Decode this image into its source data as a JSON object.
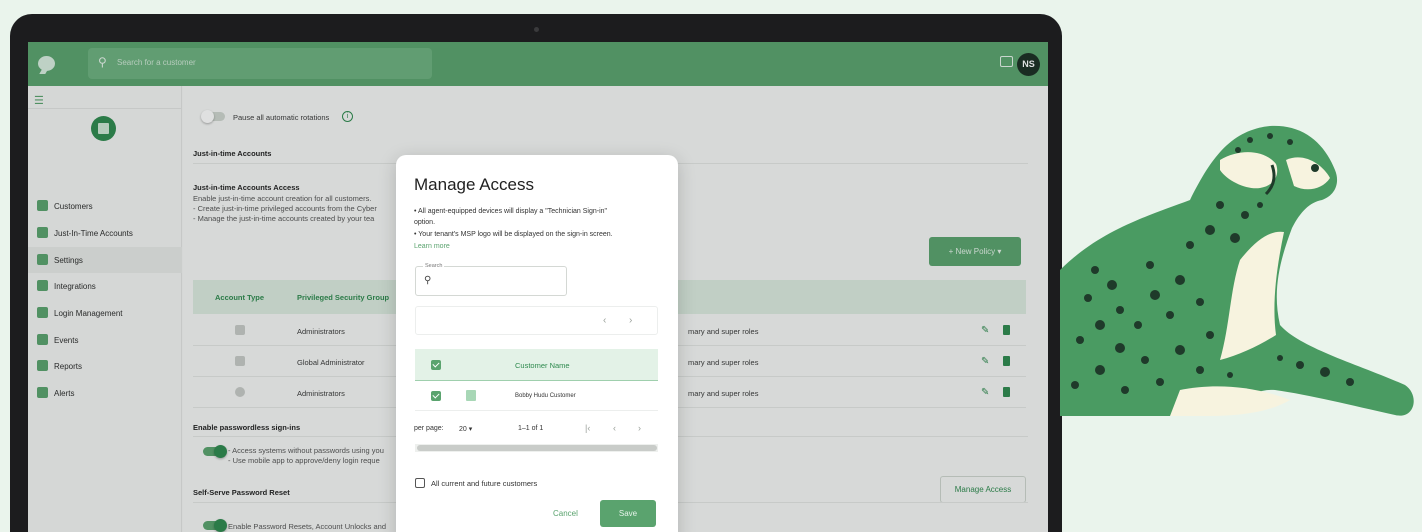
{
  "header": {
    "search_placeholder": "Search for a customer",
    "avatar_initials": "NS"
  },
  "sidebar": {
    "items": [
      {
        "label": "Customers",
        "icon": "grid-icon",
        "active": false
      },
      {
        "label": "Just-In-Time Accounts",
        "icon": "users-icon",
        "active": false
      },
      {
        "label": "Settings",
        "icon": "sliders-icon",
        "active": true
      },
      {
        "label": "Integrations",
        "icon": "plug-icon",
        "active": false
      },
      {
        "label": "Login Management",
        "icon": "hierarchy-icon",
        "active": false
      },
      {
        "label": "Events",
        "icon": "calendar-icon",
        "active": false
      },
      {
        "label": "Reports",
        "icon": "report-icon",
        "active": false
      },
      {
        "label": "Alerts",
        "icon": "bell-icon",
        "active": false
      }
    ]
  },
  "main": {
    "pause_label": "Pause all automatic rotations",
    "jit_section_title": "Just-in-time Accounts",
    "jit_access_title": "Just-in-time Accounts Access",
    "jit_lines": [
      "Enable just-in-time account creation for all customers.",
      "- Create just-in-time privileged accounts from the Cyber",
      "- Manage the just-in-time accounts created by your tea"
    ],
    "new_policy_label": "+ New Policy  ▾",
    "table": {
      "headers": [
        "Account Type",
        "Privileged Security Group"
      ],
      "rows": [
        {
          "group": "Administrators",
          "roles": "mary and super roles"
        },
        {
          "group": "Global Administrator",
          "roles": "mary and super roles"
        },
        {
          "group": "Administrators",
          "roles": "mary and super roles"
        }
      ]
    },
    "passwordless_title": "Enable passwordless sign-ins",
    "passwordless_lines": [
      "- Access systems without passwords using you",
      "- Use mobile app to approve/deny login reque"
    ],
    "manage_access_label": "Manage Access",
    "sspr_title": "Self-Serve Password Reset",
    "sspr_line": "Enable Password Resets, Account Unlocks and"
  },
  "modal": {
    "title": "Manage Access",
    "notes": [
      "• All agent-equipped devices will display a \"Technician Sign-in\"",
      "option.",
      "• Your tenant's MSP logo will be displayed on the sign-in screen."
    ],
    "learn_more": "Learn more",
    "search_label": "Search",
    "column_header": "Customer Name",
    "customers": [
      "Bobby Hudu Customer"
    ],
    "per_page_label": "per page:",
    "per_page_value": "20 ▾",
    "range": "1–1 of 1",
    "all_customers_label": "All current and future customers",
    "cancel_label": "Cancel",
    "save_label": "Save"
  },
  "colors": {
    "brand_green": "#5aa36e",
    "dark_green": "#2e8a4e",
    "background": "#eaf4ec"
  }
}
